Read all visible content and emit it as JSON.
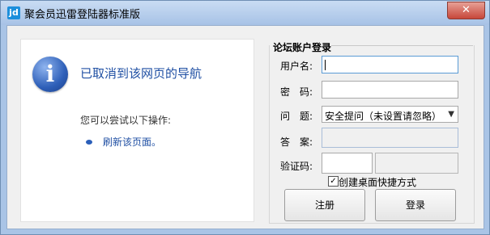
{
  "window": {
    "title": "聚会员迅雷登陆器标准版",
    "app_icon_glyph": "jd"
  },
  "title_controls": {
    "close_glyph": "✕"
  },
  "browser_error": {
    "heading": "已取消到该网页的导航",
    "suggestion": "您可以尝试以下操作:",
    "refresh_link": "刷新该页面。"
  },
  "login": {
    "group_title": "论坛账户登录",
    "username_label": "用户名:",
    "username_value": "",
    "password_label": "密　码:",
    "password_value": "",
    "question_label": "问　题:",
    "question_selected": "安全提问（未设置请忽略）",
    "answer_label": "答　案:",
    "answer_value": "",
    "captcha_label": "验证码:",
    "captcha_value": "",
    "shortcut_label": "创建桌面快捷方式",
    "shortcut_checked": true,
    "register_button": "注册",
    "login_button": "登录"
  },
  "colors": {
    "link": "#1f4fa3",
    "title_gradient_top": "#c9dcf3",
    "close_button": "#c7473a"
  }
}
